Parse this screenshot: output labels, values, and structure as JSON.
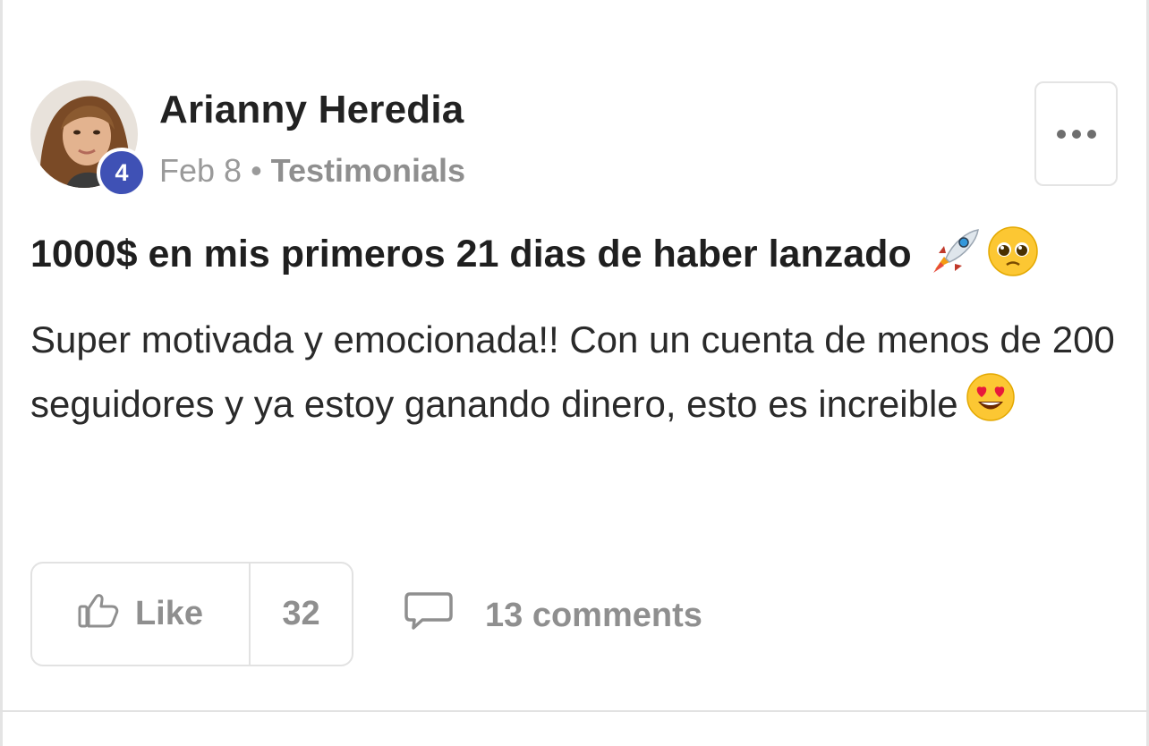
{
  "post": {
    "author": "Arianny Heredia",
    "level": "4",
    "date": "Feb 8",
    "separator": "•",
    "category": "Testimonials",
    "title": "1000$ en mis primeros 21 dias de haber lanzado",
    "title_emojis": [
      "rocket-emoji",
      "pleading-face-emoji"
    ],
    "body": "Super motivada y emocionada!! Con un cuenta de menos de 200 seguidores y ya estoy ganando dinero, esto es increible",
    "body_emoji": "heart-eyes-emoji"
  },
  "actions": {
    "like_label": "Like",
    "like_count": "32",
    "comments_label": "13 comments"
  },
  "colors": {
    "badge": "#3f51b5",
    "muted_text": "#8f8f8f",
    "border": "#e2e2e2"
  }
}
